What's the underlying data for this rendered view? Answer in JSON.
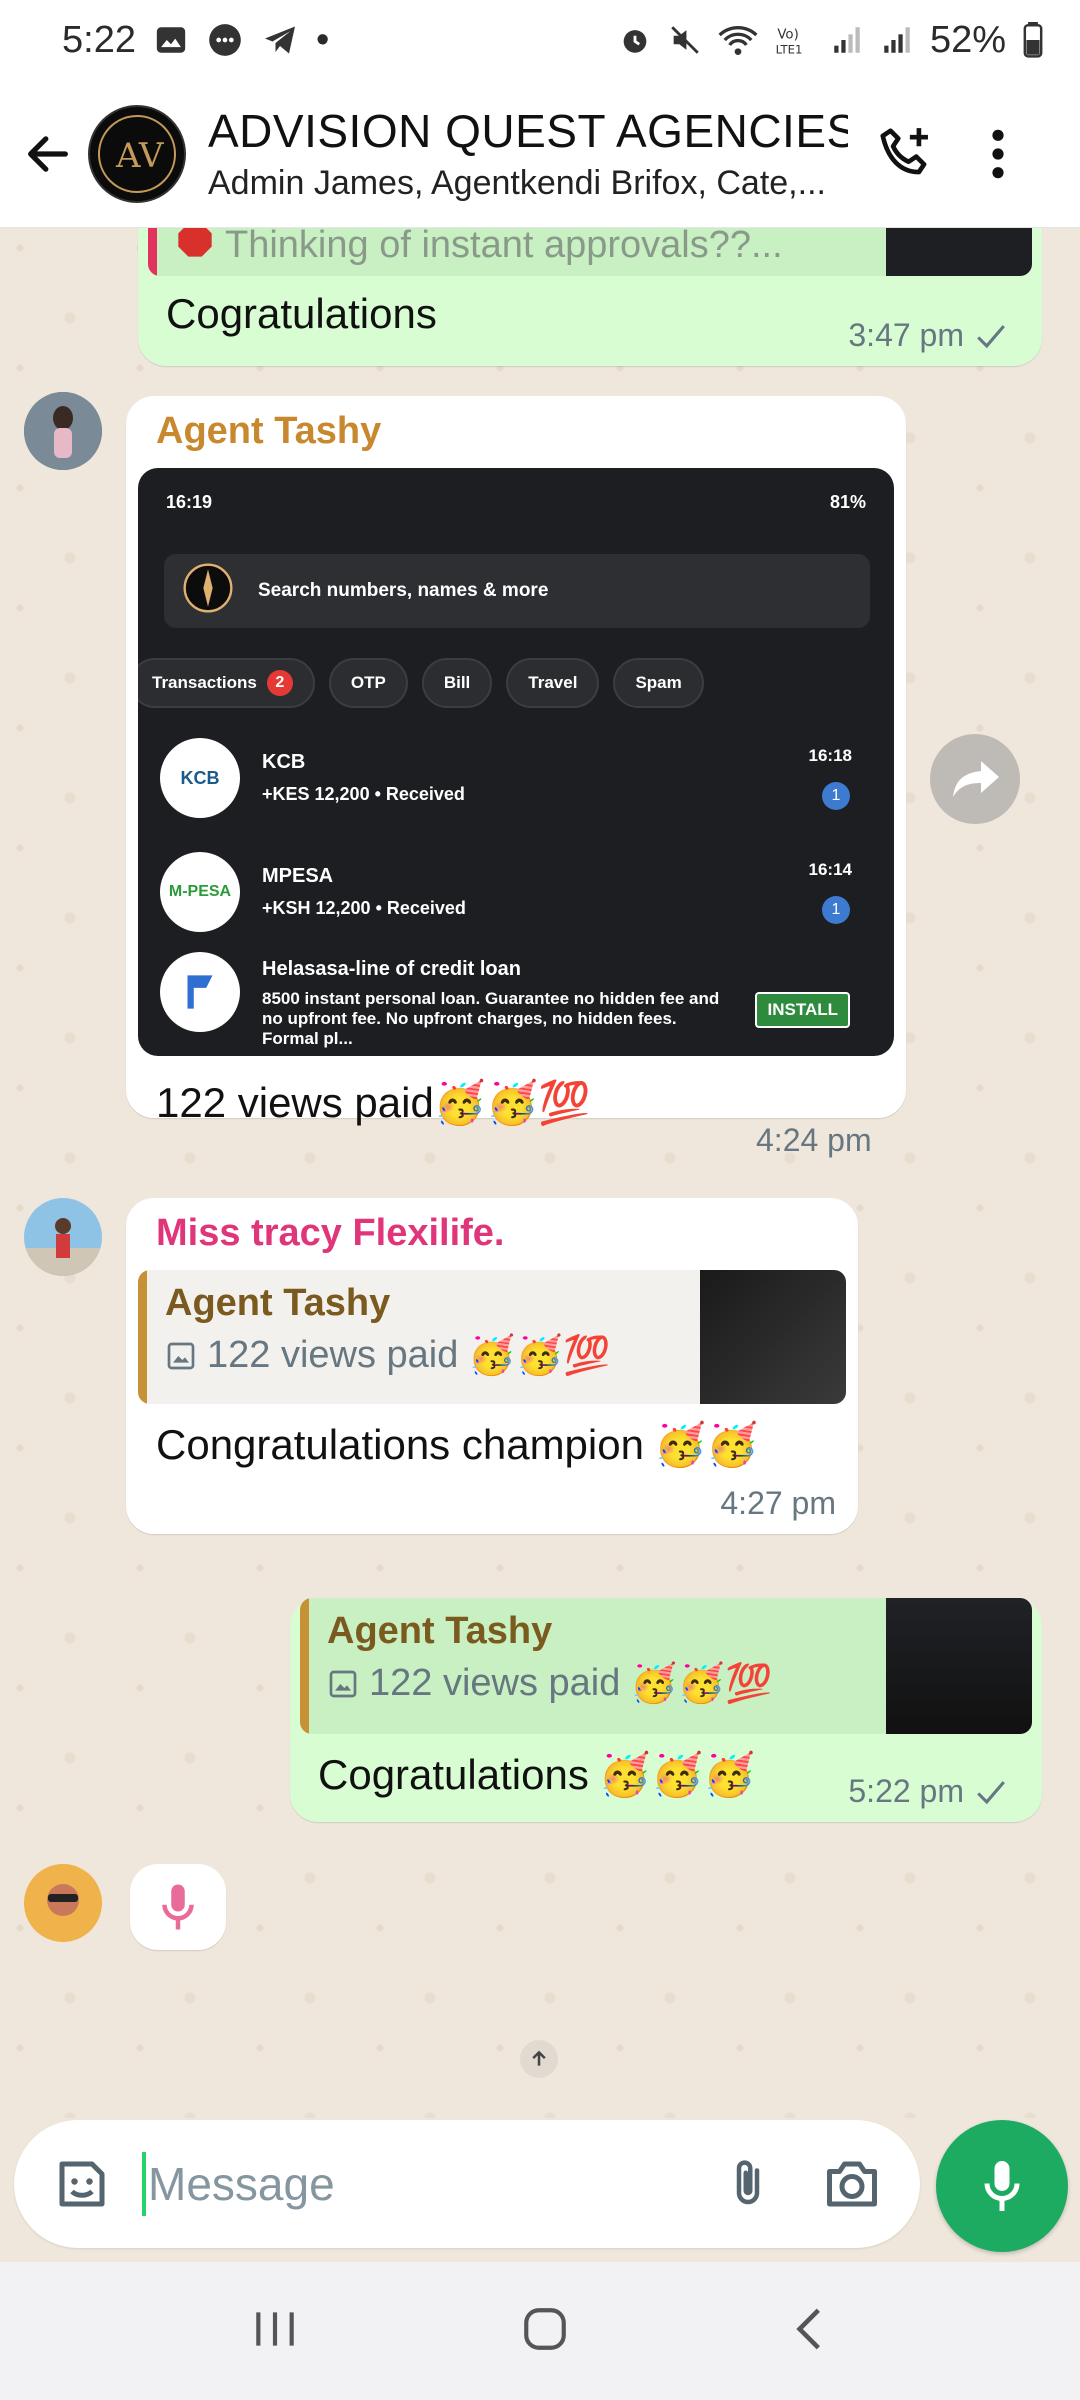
{
  "status_bar": {
    "time": "5:22",
    "dot": "•",
    "battery": "52%",
    "left_icons": [
      "gallery-icon",
      "chat-bubble-icon",
      "telegram-icon"
    ],
    "right_icons": [
      "alarm-icon",
      "mute-icon",
      "wifi-icon",
      "volte-icon",
      "signal-icon",
      "signal-icon",
      "battery-icon"
    ]
  },
  "header": {
    "title": "ADVISION QUEST AGENCIES",
    "subtitle": "Admin James, Agentkendi Brifox, Cate,...",
    "avatar_text": "AV"
  },
  "messages": {
    "m1": {
      "quote_text": "Thinking of instant approvals??...",
      "text": "Cogratulations",
      "time": "3:47 pm"
    },
    "m2": {
      "sender": "Agent Tashy",
      "sender_color": "#c8882e",
      "text": "122 views paid",
      "emoji": "🥳🥳💯",
      "time": "4:24 pm",
      "screenshot": {
        "time": "16:19",
        "status_right": "81%",
        "search_placeholder": "Search numbers, names & more",
        "chips": [
          {
            "label": "Transactions",
            "badge": "2"
          },
          {
            "label": "OTP"
          },
          {
            "label": "Bill"
          },
          {
            "label": "Travel"
          },
          {
            "label": "Spam"
          }
        ],
        "rows": [
          {
            "name": "KCB",
            "detail": "+KES 12,200 • Received",
            "time": "16:18",
            "badge": "1",
            "logo": "KCB"
          },
          {
            "name": "MPESA",
            "detail": "+KSH 12,200 • Received",
            "time": "16:14",
            "badge": "1",
            "logo": "M-PESA"
          },
          {
            "name": "Helasasa-line of credit loan",
            "detail": "8500 instant personal loan. Guarantee no hidden fee and no upfront fee. No upfront charges, no hidden fees. Formal pl...",
            "install": "INSTALL"
          }
        ]
      }
    },
    "m3": {
      "sender": "Miss tracy Flexilife.",
      "sender_color": "#e0357a",
      "quote_name": "Agent Tashy",
      "quote_text": "122 views paid",
      "quote_emoji": "🥳🥳💯",
      "text": "Congratulations champion",
      "emoji": "🥳🥳",
      "time": "4:27 pm"
    },
    "m4": {
      "quote_name": "Agent Tashy",
      "quote_text": "122 views paid",
      "quote_emoji": "🥳🥳💯",
      "text": "Cogratulations",
      "emoji": "🥳🥳🥳",
      "time": "5:22 pm"
    }
  },
  "input": {
    "placeholder": "Message"
  },
  "colors": {
    "accent": "#1daa61",
    "outgoing_bubble": "#d9fdd3",
    "incoming_bubble": "#ffffff",
    "chat_bg": "#efe7dc"
  }
}
